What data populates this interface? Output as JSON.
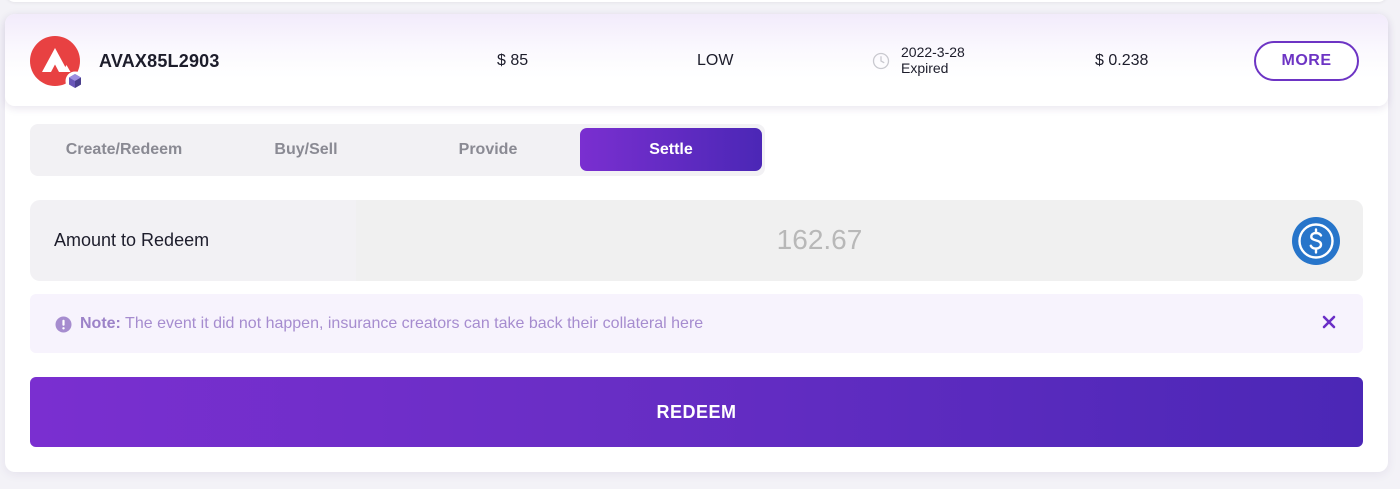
{
  "header": {
    "token_name": "AVAX85L2903",
    "strike": "$ 85",
    "risk": "LOW",
    "date": "2022-3-28",
    "status": "Expired",
    "price": "$ 0.238",
    "more_label": "MORE"
  },
  "tabs": [
    {
      "label": "Create/Redeem",
      "active": false
    },
    {
      "label": "Buy/Sell",
      "active": false
    },
    {
      "label": "Provide",
      "active": false
    },
    {
      "label": "Settle",
      "active": true
    }
  ],
  "amount": {
    "label": "Amount to Redeem",
    "value": "162.67",
    "currency_icon": "usdc-icon"
  },
  "note": {
    "prefix": "Note:",
    "text": " The event it did not happen, insurance creators can take back their collateral here"
  },
  "redeem_button": {
    "label": "REDEEM"
  },
  "colors": {
    "accent": "#6d34c4",
    "gradient_start": "#7a2fd0",
    "gradient_end": "#4b27b6",
    "avax_red": "#e84142",
    "usdc_blue": "#2775ca"
  }
}
